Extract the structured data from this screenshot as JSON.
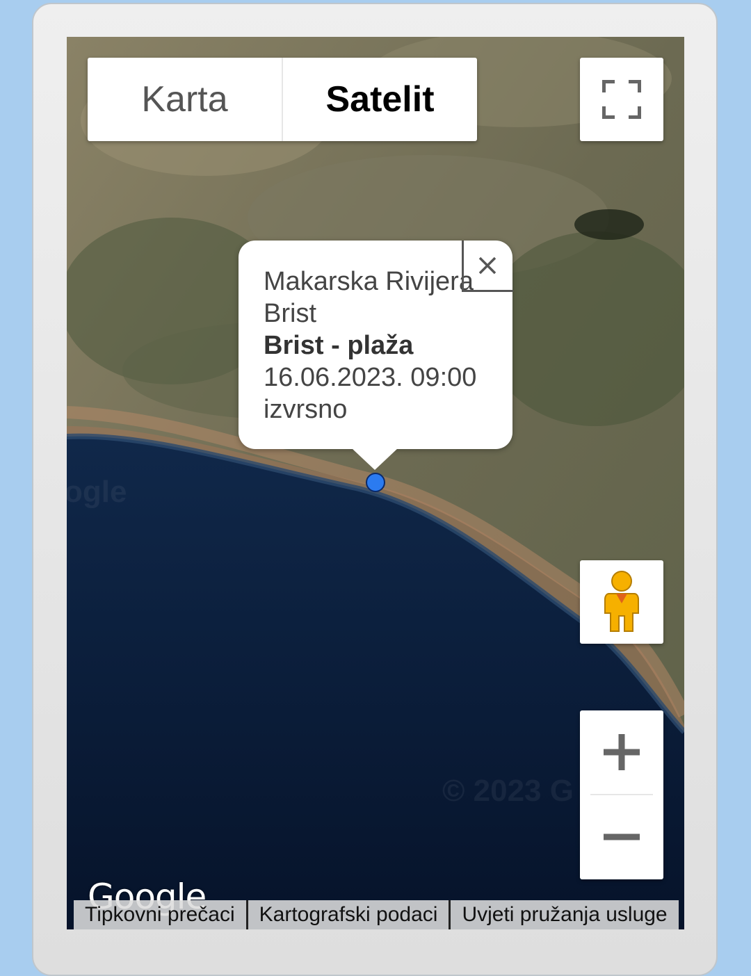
{
  "map_type": {
    "map_label": "Karta",
    "satellite_label": "Satelit",
    "selected": "Satelit"
  },
  "popup": {
    "region": "Makarska Rivijera",
    "place": "Brist",
    "location": "Brist - plaža",
    "datetime": "16.06.2023. 09:00",
    "rating": "izvrsno"
  },
  "controls": {
    "fullscreen_icon": "fullscreen-icon",
    "pegman_icon": "pegman-icon",
    "zoom_in_icon": "plus-icon",
    "zoom_out_icon": "minus-icon"
  },
  "branding": {
    "logo": "Google",
    "watermark_left": "ogle",
    "watermark_copyright": "© 2023 G"
  },
  "footer": {
    "shortcuts": "Tipkovni prečaci",
    "map_data": "Kartografski podaci",
    "terms": "Uvjeti pružanja usluge"
  },
  "colors": {
    "marker": "#2b7bf0",
    "sea": "#0b1e3d",
    "land": "#7a735c",
    "pegman": "#f6b000"
  }
}
